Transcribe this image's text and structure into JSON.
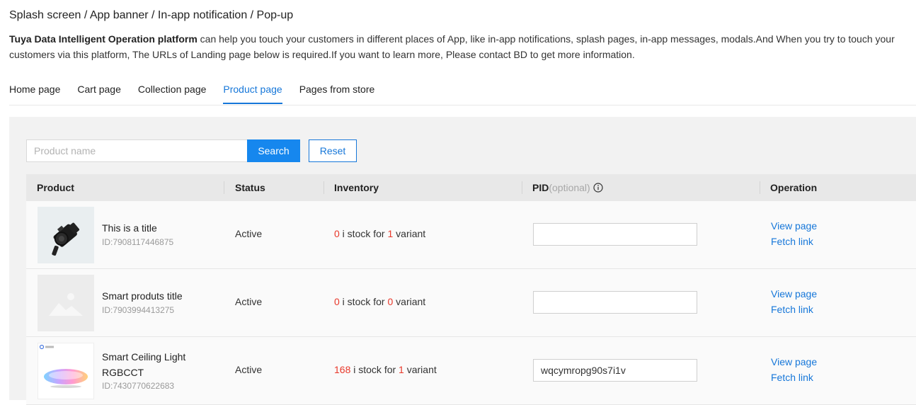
{
  "page": {
    "title": "Splash screen / App banner / In-app notification / Pop-up",
    "intro_bold": "Tuya Data Intelligent Operation platform",
    "intro_rest": " can help you touch your customers in different places of App, like in-app notifications, splash pages, in-app messages, modals.And When you try to touch your customers via this platform, The URLs of Landing page below is required.If you want to learn more, Please contact BD to get more information."
  },
  "tabs": [
    {
      "label": "Home page",
      "active": false
    },
    {
      "label": "Cart page",
      "active": false
    },
    {
      "label": "Collection page",
      "active": false
    },
    {
      "label": "Product page",
      "active": true
    },
    {
      "label": "Pages from store",
      "active": false
    }
  ],
  "search": {
    "placeholder": "Product name",
    "search_label": "Search",
    "reset_label": "Reset"
  },
  "table": {
    "headers": {
      "product": "Product",
      "status": "Status",
      "inventory": "Inventory",
      "pid": "PID",
      "pid_optional": "(optional)",
      "operation": "Operation"
    },
    "rows": [
      {
        "title": "This is a title",
        "title2": "",
        "id": "ID:7908117446875",
        "thumb": "camera-image",
        "status": "Active",
        "inv_count": "0",
        "inv_mid": " i stock for ",
        "inv_variants": "1",
        "inv_end": " variant",
        "pid_value": "",
        "view_label": "View page",
        "fetch_label": "Fetch link"
      },
      {
        "title": "Smart produts title",
        "title2": "",
        "id": "ID:7903994413275",
        "thumb": "placeholder-image-icon",
        "status": "Active",
        "inv_count": "0",
        "inv_mid": " i stock for ",
        "inv_variants": "0",
        "inv_end": " variant",
        "pid_value": "",
        "view_label": "View page",
        "fetch_label": "Fetch link"
      },
      {
        "title": "Smart Ceiling Light",
        "title2": "RGBCCT",
        "id": "ID:7430770622683",
        "thumb": "ceiling-light-image",
        "status": "Active",
        "inv_count": "168",
        "inv_mid": " i stock for ",
        "inv_variants": "1",
        "inv_end": " variant",
        "pid_value": "wqcymropg90s7i1v",
        "view_label": "View page",
        "fetch_label": "Fetch link"
      }
    ]
  },
  "colors": {
    "accent": "#1677d9",
    "button": "#1687ee",
    "stock_red": "#e8382a",
    "panel_bg": "#f2f2f2"
  }
}
